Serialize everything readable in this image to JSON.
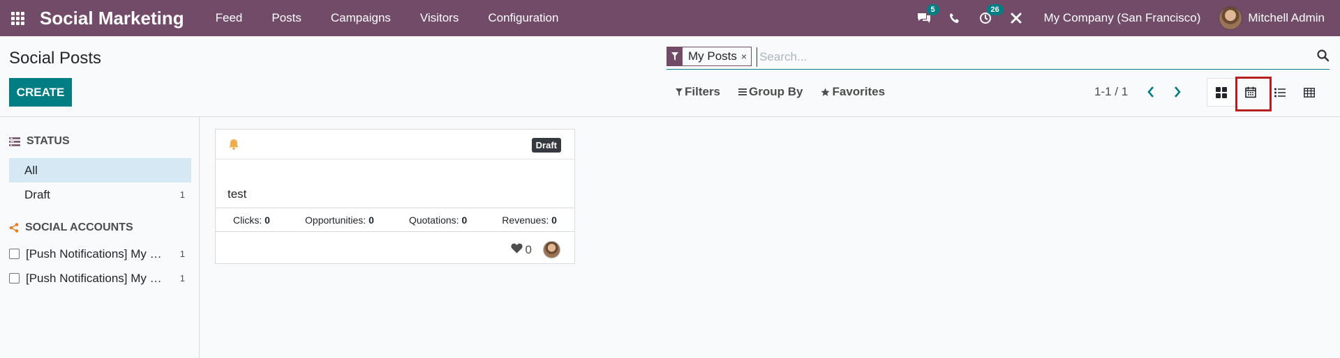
{
  "navbar": {
    "brand": "Social Marketing",
    "menu": [
      "Feed",
      "Posts",
      "Campaigns",
      "Visitors",
      "Configuration"
    ],
    "messages_count": "5",
    "activities_count": "26",
    "company": "My Company (San Francisco)",
    "user": "Mitchell Admin",
    "bg_color": "#714b67"
  },
  "control": {
    "title": "Social Posts",
    "create_label": "CREATE",
    "search": {
      "facet_label": "My Posts",
      "facet_remove": "×",
      "placeholder": "Search..."
    },
    "filters_label": "Filters",
    "groupby_label": "Group By",
    "favorites_label": "Favorites",
    "pager": "1-1 / 1",
    "views": [
      "kanban-icon",
      "calendar-icon",
      "list-icon",
      "pivot-icon"
    ],
    "active_view": "kanban"
  },
  "sidebar": {
    "status_header": "STATUS",
    "status_items": [
      {
        "label": "All",
        "count": ""
      },
      {
        "label": "Draft",
        "count": "1"
      }
    ],
    "accounts_header": "SOCIAL ACCOUNTS",
    "accounts": [
      {
        "label": "[Push Notifications] My Company (San Francisco)",
        "count": "1"
      },
      {
        "label": "[Push Notifications] My Company (San Francisco)",
        "count": "1"
      }
    ]
  },
  "card": {
    "status_badge": "Draft",
    "name": "test",
    "stats": [
      {
        "label": "Clicks:",
        "value": "0"
      },
      {
        "label": "Opportunities:",
        "value": "0"
      },
      {
        "label": "Quotations:",
        "value": "0"
      },
      {
        "label": "Revenues:",
        "value": "0"
      }
    ],
    "likes": "0"
  },
  "colors": {
    "accent": "#017e84",
    "brand": "#714b67",
    "highlight": "#b41f1f",
    "bell": "#f0ad4e"
  }
}
